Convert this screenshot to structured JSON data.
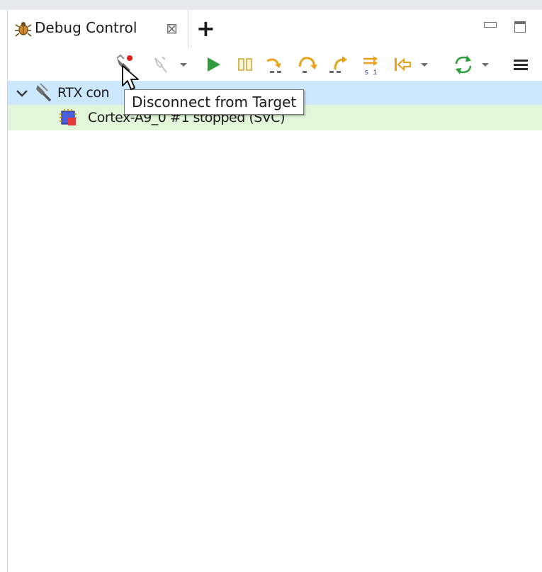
{
  "view": {
    "tab_title": "Debug Control",
    "tab_close_glyph": "⊠",
    "new_tab_glyph": "+"
  },
  "toolbar": {
    "items": [
      {
        "name": "disconnect-from-target-icon"
      },
      {
        "name": "connect-to-target-icon"
      },
      {
        "name": "dropdown-arrow-icon"
      },
      {
        "name": "continue-icon"
      },
      {
        "name": "interrupt-icon"
      },
      {
        "name": "step-into-icon"
      },
      {
        "name": "step-over-icon"
      },
      {
        "name": "step-out-icon"
      },
      {
        "name": "step-instruction-icon"
      },
      {
        "name": "reverse-debug-icon"
      },
      {
        "name": "dropdown-arrow-icon"
      },
      {
        "name": "refresh-icon"
      },
      {
        "name": "dropdown-arrow-icon"
      },
      {
        "name": "view-menu-icon"
      }
    ]
  },
  "tree": {
    "connection_label": "RTX con",
    "core_label": "Cortex-A9_0 #1 stopped (SVC)"
  },
  "tooltip": {
    "text": "Disconnect from Target"
  },
  "colors": {
    "selected_row": "#cce8ff",
    "stopped_row": "#e2f6d9",
    "continue_green": "#2e9e3e",
    "step_orange": "#e8a317"
  }
}
